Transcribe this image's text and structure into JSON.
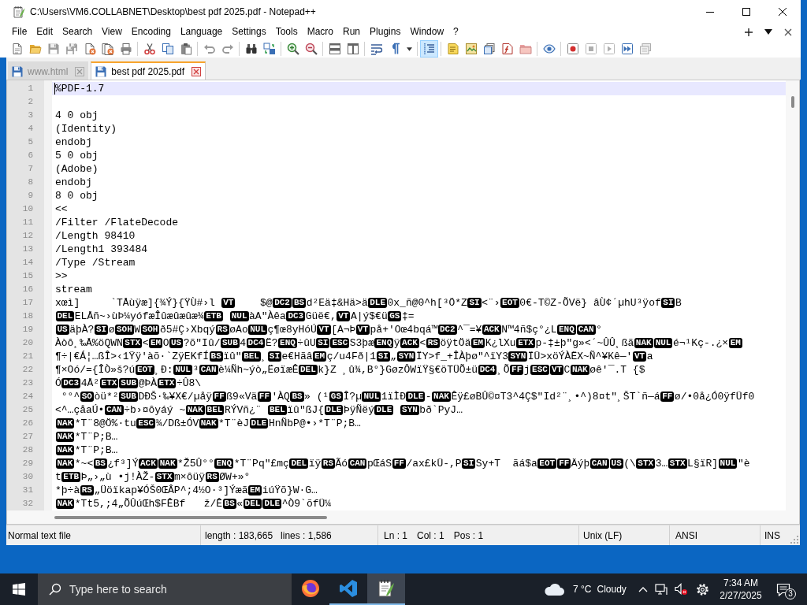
{
  "window": {
    "title": "C:\\Users\\VM6.COLLABNET\\Desktop\\best pdf 2025.pdf - Notepad++"
  },
  "menu": [
    "File",
    "Edit",
    "Search",
    "View",
    "Encoding",
    "Language",
    "Settings",
    "Tools",
    "Macro",
    "Run",
    "Plugins",
    "Window",
    "?"
  ],
  "toolbar": {
    "groups": [
      {
        "buttons": [
          {
            "kind": "new",
            "pressed": false,
            "disabled": false
          },
          {
            "kind": "open",
            "pressed": false,
            "disabled": false
          },
          {
            "kind": "save",
            "pressed": false,
            "disabled": true
          },
          {
            "kind": "saveall",
            "pressed": false,
            "disabled": true
          },
          {
            "kind": "close",
            "pressed": false,
            "disabled": false
          },
          {
            "kind": "closeall",
            "pressed": false,
            "disabled": false
          },
          {
            "kind": "print",
            "pressed": false,
            "disabled": false
          }
        ]
      },
      {
        "buttons": [
          {
            "kind": "cut",
            "pressed": false,
            "disabled": false
          },
          {
            "kind": "copy",
            "pressed": false,
            "disabled": false
          },
          {
            "kind": "paste",
            "pressed": false,
            "disabled": false
          }
        ]
      },
      {
        "buttons": [
          {
            "kind": "undo",
            "pressed": false,
            "disabled": true
          },
          {
            "kind": "redo",
            "pressed": false,
            "disabled": true
          }
        ]
      },
      {
        "buttons": [
          {
            "kind": "find",
            "pressed": false,
            "disabled": false
          },
          {
            "kind": "replace",
            "pressed": false,
            "disabled": false
          }
        ]
      },
      {
        "buttons": [
          {
            "kind": "zoomin",
            "pressed": false,
            "disabled": false
          },
          {
            "kind": "zoomout",
            "pressed": false,
            "disabled": false
          }
        ]
      },
      {
        "buttons": [
          {
            "kind": "syncv",
            "pressed": false,
            "disabled": false
          },
          {
            "kind": "synch",
            "pressed": false,
            "disabled": false
          }
        ]
      },
      {
        "buttons": [
          {
            "kind": "wrap",
            "pressed": false,
            "disabled": false
          },
          {
            "kind": "allchars",
            "pressed": false,
            "disabled": false
          },
          {
            "kind": "menu",
            "pressed": false,
            "disabled": false
          }
        ]
      },
      {
        "buttons": [
          {
            "kind": "indentguide",
            "pressed": true,
            "disabled": false
          }
        ]
      },
      {
        "buttons": [
          {
            "kind": "udl",
            "pressed": false,
            "disabled": false
          },
          {
            "kind": "docmap",
            "pressed": false,
            "disabled": false
          },
          {
            "kind": "doclist",
            "pressed": false,
            "disabled": false
          },
          {
            "kind": "funclist",
            "pressed": false,
            "disabled": false
          },
          {
            "kind": "workspace",
            "pressed": false,
            "disabled": false
          }
        ]
      },
      {
        "buttons": [
          {
            "kind": "monitor",
            "pressed": false,
            "disabled": false
          }
        ]
      },
      {
        "buttons": [
          {
            "kind": "record",
            "pressed": false,
            "disabled": false
          },
          {
            "kind": "stop",
            "pressed": false,
            "disabled": true
          },
          {
            "kind": "play",
            "pressed": false,
            "disabled": true
          },
          {
            "kind": "playmulti",
            "pressed": false,
            "disabled": false
          },
          {
            "kind": "savemacro",
            "pressed": false,
            "disabled": true
          }
        ]
      }
    ]
  },
  "tabs": [
    {
      "label": "www.html",
      "selected": false
    },
    {
      "label": "best pdf 2025.pdf",
      "selected": true
    }
  ],
  "editor": {
    "lines": [
      {
        "number": "1",
        "current": true,
        "segments": [
          {
            "kind": "text",
            "text": "%PDF-1.7"
          }
        ]
      },
      {
        "number": "2",
        "current": false
      },
      {
        "number": "3",
        "current": false,
        "segments": [
          {
            "kind": "text",
            "text": "4 0 obj"
          }
        ]
      },
      {
        "number": "4",
        "current": false,
        "segments": [
          {
            "kind": "text",
            "text": "(Identity)"
          }
        ]
      },
      {
        "number": "5",
        "current": false,
        "segments": [
          {
            "kind": "text",
            "text": "endobj"
          }
        ]
      },
      {
        "number": "6",
        "current": false,
        "segments": [
          {
            "kind": "text",
            "text": "5 0 obj"
          }
        ]
      },
      {
        "number": "7",
        "current": false,
        "segments": [
          {
            "kind": "text",
            "text": "(Adobe)"
          }
        ]
      },
      {
        "number": "8",
        "current": false,
        "segments": [
          {
            "kind": "text",
            "text": "endobj"
          }
        ]
      },
      {
        "number": "9",
        "current": false,
        "segments": [
          {
            "kind": "text",
            "text": "8 0 obj"
          }
        ]
      },
      {
        "number": "10",
        "current": false,
        "segments": [
          {
            "kind": "text",
            "text": "<<"
          }
        ]
      },
      {
        "number": "11",
        "current": false,
        "segments": [
          {
            "kind": "text",
            "text": "/Filter /FlateDecode"
          }
        ]
      },
      {
        "number": "12",
        "current": false,
        "segments": [
          {
            "kind": "text",
            "text": "/Length 98410"
          }
        ]
      },
      {
        "number": "13",
        "current": false,
        "segments": [
          {
            "kind": "text",
            "text": "/Length1 393484"
          }
        ]
      },
      {
        "number": "14",
        "current": false,
        "segments": [
          {
            "kind": "text",
            "text": "/Type /Stream"
          }
        ]
      },
      {
        "number": "15",
        "current": false,
        "segments": [
          {
            "kind": "text",
            "text": ">>"
          }
        ]
      },
      {
        "number": "16",
        "current": false,
        "segments": [
          {
            "kind": "text",
            "text": "stream"
          }
        ]
      },
      {
        "number": "17",
        "current": false,
        "segments": [
          {
            "kind": "text",
            "text": "xœì]     `TÅùÿæ]{¾Ý}{ŸÙ#›l "
          },
          {
            "kind": "control",
            "text": "VT"
          },
          {
            "kind": "text",
            "text": "    $@"
          },
          {
            "kind": "control",
            "text": "DC2"
          },
          {
            "kind": "control",
            "text": "BS"
          },
          {
            "kind": "text",
            "text": "d²Eä‡&Hä>ä"
          },
          {
            "kind": "control",
            "text": "DLE"
          },
          {
            "kind": "text",
            "text": "0x_ñ@0^h[³Ö*Z"
          },
          {
            "kind": "control",
            "text": "SI"
          },
          {
            "kind": "text",
            "text": "<¨›"
          },
          {
            "kind": "control",
            "text": "EOT"
          },
          {
            "kind": "text",
            "text": "0€-T©Z-ÕVë} âÙ¢´µhU³ÿof"
          },
          {
            "kind": "control",
            "text": "SI"
          },
          {
            "kind": "text",
            "text": "B"
          }
        ]
      },
      {
        "number": "18",
        "current": false,
        "segments": [
          {
            "kind": "control",
            "text": "DEL"
          },
          {
            "kind": "text",
            "text": "ELÅñ~›ùÞ¼yófæÎûæûæûæ¾"
          },
          {
            "kind": "control",
            "text": "ETB"
          },
          {
            "kind": "space"
          },
          {
            "kind": "control",
            "text": "NUL"
          },
          {
            "kind": "text",
            "text": "àA\"Àêa"
          },
          {
            "kind": "control",
            "text": "DC3"
          },
          {
            "kind": "text",
            "text": "Güë€,"
          },
          {
            "kind": "control",
            "text": "VT"
          },
          {
            "kind": "text",
            "text": "A|ý$€ü"
          },
          {
            "kind": "control",
            "text": "GS"
          },
          {
            "kind": "text",
            "text": "‡="
          }
        ]
      },
      {
        "number": "19",
        "current": false,
        "segments": [
          {
            "kind": "control",
            "text": "US"
          },
          {
            "kind": "text",
            "text": "äþÀ?"
          },
          {
            "kind": "control",
            "text": "SI"
          },
          {
            "kind": "text",
            "text": "ø"
          },
          {
            "kind": "control",
            "text": "SOH"
          },
          {
            "kind": "text",
            "text": "W"
          },
          {
            "kind": "control",
            "text": "SOH"
          },
          {
            "kind": "text",
            "text": "ð5#Ç›Xbqý"
          },
          {
            "kind": "control",
            "text": "RS"
          },
          {
            "kind": "text",
            "text": "øAo"
          },
          {
            "kind": "control",
            "text": "NUL"
          },
          {
            "kind": "text",
            "text": "ç¶œ8yHóÚ"
          },
          {
            "kind": "control",
            "text": "VT"
          },
          {
            "kind": "text",
            "text": "[A¬Þ"
          },
          {
            "kind": "control",
            "text": "VT"
          },
          {
            "kind": "text",
            "text": "på+'Oœ4bqá™"
          },
          {
            "kind": "control",
            "text": "DC2"
          },
          {
            "kind": "text",
            "text": "^¯=¥"
          },
          {
            "kind": "control",
            "text": "ACK"
          },
          {
            "kind": "text",
            "text": "N™4ñ$ç°¿L"
          },
          {
            "kind": "control",
            "text": "ENQ"
          },
          {
            "kind": "control",
            "text": "CAN"
          },
          {
            "kind": "text",
            "text": "°"
          }
        ]
      },
      {
        "number": "20",
        "current": false,
        "segments": [
          {
            "kind": "text",
            "text": "Àòô¸‰Å%öQWN"
          },
          {
            "kind": "control",
            "text": "STX"
          },
          {
            "kind": "text",
            "text": "<"
          },
          {
            "kind": "control",
            "text": "EM"
          },
          {
            "kind": "text",
            "text": "O"
          },
          {
            "kind": "control",
            "text": "US"
          },
          {
            "kind": "text",
            "text": "?õ\"Iû/"
          },
          {
            "kind": "control",
            "text": "SUB"
          },
          {
            "kind": "text",
            "text": "4"
          },
          {
            "kind": "control",
            "text": "DC4"
          },
          {
            "kind": "text",
            "text": "Ë?"
          },
          {
            "kind": "control",
            "text": "ENQ"
          },
          {
            "kind": "text",
            "text": "÷ûU"
          },
          {
            "kind": "control",
            "text": "SI"
          },
          {
            "kind": "control",
            "text": "ESC"
          },
          {
            "kind": "text",
            "text": "S3þæ"
          },
          {
            "kind": "control",
            "text": "ENQ"
          },
          {
            "kind": "text",
            "text": "ÿ"
          },
          {
            "kind": "control",
            "text": "ACK"
          },
          {
            "kind": "text",
            "text": "<"
          },
          {
            "kind": "control",
            "text": "RS"
          },
          {
            "kind": "text",
            "text": "öÿtÖä"
          },
          {
            "kind": "control",
            "text": "EM"
          },
          {
            "kind": "text",
            "text": "K¿lXu"
          },
          {
            "kind": "control",
            "text": "ETX"
          },
          {
            "kind": "text",
            "text": "p-‡±þ\"g»<´~ÛÛ¸ßã"
          },
          {
            "kind": "control",
            "text": "NAK"
          },
          {
            "kind": "control",
            "text": "NUL"
          },
          {
            "kind": "text",
            "text": "é¬¹Kç-.¿×"
          },
          {
            "kind": "control",
            "text": "EM"
          }
        ]
      },
      {
        "number": "21",
        "current": false,
        "segments": [
          {
            "kind": "text",
            "text": "¶÷|€Á¦…ßÎ>‹1Ÿÿ'àõ·`ZÿEKfÍ"
          },
          {
            "kind": "control",
            "text": "BS"
          },
          {
            "kind": "text",
            "text": "ïû\""
          },
          {
            "kind": "control",
            "text": "BEL"
          },
          {
            "kind": "text",
            "text": "¸"
          },
          {
            "kind": "control",
            "text": "SI"
          },
          {
            "kind": "text",
            "text": "e€Hãâ"
          },
          {
            "kind": "control",
            "text": "EM"
          },
          {
            "kind": "text",
            "text": "ç/u4Fð|1"
          },
          {
            "kind": "control",
            "text": "SI"
          },
          {
            "kind": "text",
            "text": "„"
          },
          {
            "kind": "control",
            "text": "SYN"
          },
          {
            "kind": "text",
            "text": "ÏY>f_+ÎÀþø\"^ïY3"
          },
          {
            "kind": "control",
            "text": "SYN"
          },
          {
            "kind": "text",
            "text": "ÏÜ>xöÝÀËX~Ñ^¥Kê—'"
          },
          {
            "kind": "control",
            "text": "VT"
          },
          {
            "kind": "text",
            "text": "a"
          }
        ]
      },
      {
        "number": "22",
        "current": false,
        "segments": [
          {
            "kind": "text",
            "text": "¶×Oó/={ÎÒ»š?ú"
          },
          {
            "kind": "control",
            "text": "EOT"
          },
          {
            "kind": "text",
            "text": "¸Ð:"
          },
          {
            "kind": "control",
            "text": "NUL"
          },
          {
            "kind": "text",
            "text": "³"
          },
          {
            "kind": "control",
            "text": "CAN"
          },
          {
            "kind": "text",
            "text": "è¼Ñh~ýò„ËøïæÊ"
          },
          {
            "kind": "control",
            "text": "DEL"
          },
          {
            "kind": "text",
            "text": "k}Z ¸û¾,B°}GøzÔWïŸ§€öTÜÕ±ü"
          },
          {
            "kind": "control",
            "text": "DC4"
          },
          {
            "kind": "text",
            "text": "¸Õ"
          },
          {
            "kind": "control",
            "text": "FF"
          },
          {
            "kind": "text",
            "text": "j"
          },
          {
            "kind": "control",
            "text": "ESC"
          },
          {
            "kind": "control",
            "text": "VT"
          },
          {
            "kind": "text",
            "text": "C"
          },
          {
            "kind": "control",
            "text": "NAK"
          },
          {
            "kind": "text",
            "text": "øê'¯.T {$"
          }
        ]
      },
      {
        "number": "23",
        "current": false,
        "segments": [
          {
            "kind": "text",
            "text": "Ó"
          },
          {
            "kind": "control",
            "text": "DC3"
          },
          {
            "kind": "text",
            "text": "4Å²"
          },
          {
            "kind": "control",
            "text": "ETX"
          },
          {
            "kind": "control",
            "text": "SUB"
          },
          {
            "kind": "text",
            "text": "@ÞÀ"
          },
          {
            "kind": "control",
            "text": "ETX"
          },
          {
            "kind": "text",
            "text": "÷Û8\\"
          }
        ]
      },
      {
        "number": "24",
        "current": false,
        "segments": [
          {
            "kind": "text",
            "text": " °°^"
          },
          {
            "kind": "control",
            "text": "SO"
          },
          {
            "kind": "text",
            "text": "òü*²"
          },
          {
            "kind": "control",
            "text": "SUB"
          },
          {
            "kind": "text",
            "text": "DÐŠ·‰¥X€/µåÿ"
          },
          {
            "kind": "control",
            "text": "FF"
          },
          {
            "kind": "text",
            "text": "ß9«Vä"
          },
          {
            "kind": "control",
            "text": "FF"
          },
          {
            "kind": "text",
            "text": "'ÀQ"
          },
          {
            "kind": "control",
            "text": "BS"
          },
          {
            "kind": "text",
            "text": "» (¹"
          },
          {
            "kind": "control",
            "text": "GS"
          },
          {
            "kind": "text",
            "text": "Î?µ"
          },
          {
            "kind": "control",
            "text": "NUL"
          },
          {
            "kind": "text",
            "text": "1ïÌÐ"
          },
          {
            "kind": "control",
            "text": "DLE"
          },
          {
            "kind": "text",
            "text": "-"
          },
          {
            "kind": "control",
            "text": "NAK"
          },
          {
            "kind": "text",
            "text": "Êÿ£øBÛ©¤T3^4Ç$\"Id²¨¸•^)8¤t\"¸ŠT`ñ—á"
          },
          {
            "kind": "control",
            "text": "FF"
          },
          {
            "kind": "text",
            "text": "ø/•0å¿Ó0ÿfÜf0"
          }
        ]
      },
      {
        "number": "25",
        "current": false,
        "segments": [
          {
            "kind": "text",
            "text": "<^…çåaÚ•"
          },
          {
            "kind": "control",
            "text": "CAN"
          },
          {
            "kind": "text",
            "text": "÷b›¤ôyáý ~"
          },
          {
            "kind": "control",
            "text": "NAK"
          },
          {
            "kind": "control",
            "text": "BEL"
          },
          {
            "kind": "text",
            "text": "RÝVñ¿¨ "
          },
          {
            "kind": "control",
            "text": "BEL"
          },
          {
            "kind": "text",
            "text": "ïû\"ßJ{"
          },
          {
            "kind": "control",
            "text": "DLE"
          },
          {
            "kind": "text",
            "text": "ÞÿÑëý"
          },
          {
            "kind": "control",
            "text": "DLE"
          },
          {
            "kind": "space"
          },
          {
            "kind": "control",
            "text": "SYN"
          },
          {
            "kind": "text",
            "text": "bð`PyJ…"
          }
        ]
      },
      {
        "number": "26",
        "current": false,
        "segments": [
          {
            "kind": "control",
            "text": "NAK"
          },
          {
            "kind": "text",
            "text": "*T¨8@Ö%·tu"
          },
          {
            "kind": "control",
            "text": "ESC"
          },
          {
            "kind": "text",
            "text": "¾/Dß±ÓV"
          },
          {
            "kind": "control",
            "text": "NAK"
          },
          {
            "kind": "text",
            "text": "*T¨èJ"
          },
          {
            "kind": "control",
            "text": "DLE"
          },
          {
            "kind": "text",
            "text": "HnÑbP@•›*T¨P;B…"
          }
        ]
      },
      {
        "number": "27",
        "current": false,
        "segments": [
          {
            "kind": "control",
            "text": "NAK"
          },
          {
            "kind": "text",
            "text": "*T¨P;B…"
          }
        ]
      },
      {
        "number": "28",
        "current": false,
        "segments": [
          {
            "kind": "control",
            "text": "NAK"
          },
          {
            "kind": "text",
            "text": "*T¨P;B…"
          }
        ]
      },
      {
        "number": "29",
        "current": false,
        "segments": [
          {
            "kind": "control",
            "text": "NAK"
          },
          {
            "kind": "text",
            "text": "*~<"
          },
          {
            "kind": "control",
            "text": "BS"
          },
          {
            "kind": "text",
            "text": "¿f³]Ý"
          },
          {
            "kind": "control",
            "text": "ACK"
          },
          {
            "kind": "control",
            "text": "NAK"
          },
          {
            "kind": "text",
            "text": "*Ž5Û°°"
          },
          {
            "kind": "control",
            "text": "ENQ"
          },
          {
            "kind": "text",
            "text": "*T¨Pq\"£mç"
          },
          {
            "kind": "control",
            "text": "DEL"
          },
          {
            "kind": "text",
            "text": "ïÿ"
          },
          {
            "kind": "control",
            "text": "RS"
          },
          {
            "kind": "text",
            "text": "Ãó"
          },
          {
            "kind": "control",
            "text": "CAN"
          },
          {
            "kind": "text",
            "text": "pŒáS"
          },
          {
            "kind": "control",
            "text": "FF"
          },
          {
            "kind": "text",
            "text": "/ax£kÜ-,P"
          },
          {
            "kind": "control",
            "text": "SI"
          },
          {
            "kind": "text",
            "text": "Sy+T  ãá$a"
          },
          {
            "kind": "control",
            "text": "EOT"
          },
          {
            "kind": "control",
            "text": "FF"
          },
          {
            "kind": "text",
            "text": "Äýþ"
          },
          {
            "kind": "control",
            "text": "CAN"
          },
          {
            "kind": "control",
            "text": "US"
          },
          {
            "kind": "text",
            "text": "(\\"
          },
          {
            "kind": "control",
            "text": "STX"
          },
          {
            "kind": "text",
            "text": "3…"
          },
          {
            "kind": "control",
            "text": "STX"
          },
          {
            "kind": "text",
            "text": "L§ïR]"
          },
          {
            "kind": "control",
            "text": "NUL"
          },
          {
            "kind": "text",
            "text": "\"è"
          }
        ]
      },
      {
        "number": "30",
        "current": false,
        "segments": [
          {
            "kind": "text",
            "text": "t"
          },
          {
            "kind": "control",
            "text": "ETB"
          },
          {
            "kind": "text",
            "text": "Þ„›„ù •j!ÀŽ-"
          },
          {
            "kind": "control",
            "text": "STX"
          },
          {
            "kind": "text",
            "text": "m×ôüÿ"
          },
          {
            "kind": "control",
            "text": "RS"
          },
          {
            "kind": "text",
            "text": "ØW+»°"
          }
        ]
      },
      {
        "number": "31",
        "current": false,
        "segments": [
          {
            "kind": "text",
            "text": "*þ÷à"
          },
          {
            "kind": "control",
            "text": "RS"
          },
          {
            "kind": "text",
            "text": "„Üöïkap¥ÓŠ0ŒÂP^;4½O·³]Ýæã"
          },
          {
            "kind": "control",
            "text": "EM"
          },
          {
            "kind": "text",
            "text": "iúŸõ}W·G…"
          }
        ]
      },
      {
        "number": "32",
        "current": false,
        "segments": [
          {
            "kind": "control",
            "text": "NAK"
          },
          {
            "kind": "text",
            "text": "*Tt5,;4„ÕÛúŒh$FÊBf   ž/Ê"
          },
          {
            "kind": "control",
            "text": "BS"
          },
          {
            "kind": "text",
            "text": "«"
          },
          {
            "kind": "control",
            "text": "DEL"
          },
          {
            "kind": "control",
            "text": "DLE"
          },
          {
            "kind": "text",
            "text": "^Ò9`õfÜ¼"
          }
        ]
      }
    ]
  },
  "status_bar": {
    "file_type": "Normal text file",
    "length": "length : 183,665",
    "lines": "lines : 1,586",
    "line": "Ln : 1",
    "column": "Col : 1",
    "position": "Pos : 1",
    "line_ending": "Unix (LF)",
    "encoding": "ANSI",
    "mode": "INS"
  },
  "taskbar": {
    "search": {
      "placeholder": "Type here to search"
    },
    "apps": [
      {
        "kind": "browser",
        "running": false,
        "active": false
      },
      {
        "kind": "code",
        "running": true,
        "active": false
      },
      {
        "kind": "notepad",
        "running": true,
        "active": true
      }
    ],
    "weather": {
      "temperature": "7 °C",
      "condition": "Cloudy"
    },
    "clock": {
      "time": "7:34 AM",
      "date": "2/27/2025"
    },
    "notifications": {
      "count": "3"
    }
  }
}
